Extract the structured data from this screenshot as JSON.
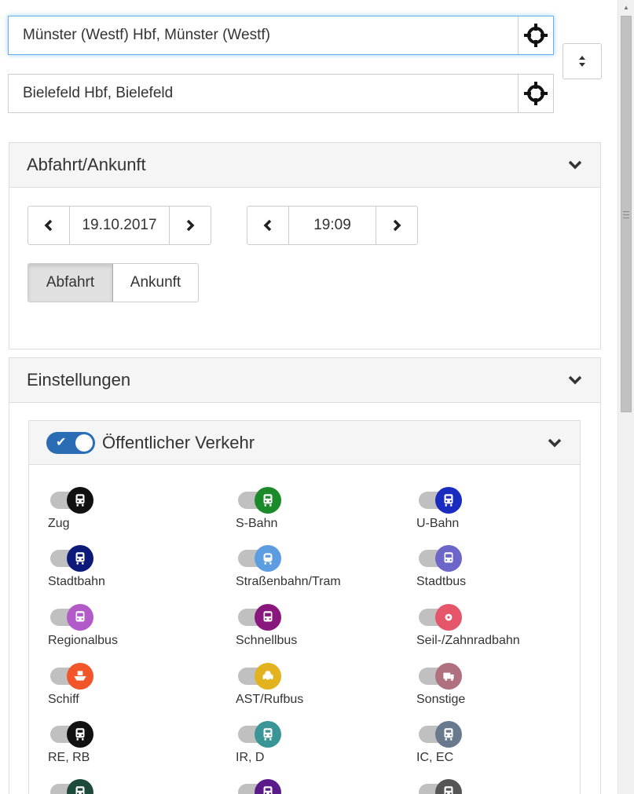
{
  "origin": {
    "value": "Münster (Westf) Hbf, Münster (Westf)",
    "locate_icon": "crosshair-icon"
  },
  "destination": {
    "value": "Bielefeld Hbf, Bielefeld",
    "locate_icon": "crosshair-icon"
  },
  "swap_icon": "sort-icon",
  "time_panel": {
    "title": "Abfahrt/Ankunft",
    "date": "19.10.2017",
    "time": "19:09",
    "departure_label": "Abfahrt",
    "arrival_label": "Ankunft",
    "selected": "Abfahrt"
  },
  "settings_panel": {
    "title": "Einstellungen",
    "public_transport": {
      "title": "Öffentlicher Verkehr",
      "enabled": true,
      "modes": [
        {
          "label": "Zug",
          "color": "#111111",
          "icon": "train-icon",
          "enabled": false
        },
        {
          "label": "S-Bahn",
          "color": "#1a8a2a",
          "icon": "train-icon",
          "enabled": false
        },
        {
          "label": "U-Bahn",
          "color": "#1a2bbf",
          "icon": "train-icon",
          "enabled": false
        },
        {
          "label": "Stadtbahn",
          "color": "#0d1a7a",
          "icon": "train-icon",
          "enabled": false
        },
        {
          "label": "Straßenbahn/Tram",
          "color": "#5b9de0",
          "icon": "tram-icon",
          "enabled": false
        },
        {
          "label": "Stadtbus",
          "color": "#6b66c7",
          "icon": "bus-icon",
          "enabled": false
        },
        {
          "label": "Regionalbus",
          "color": "#b35ac9",
          "icon": "bus-icon",
          "enabled": false
        },
        {
          "label": "Schnellbus",
          "color": "#8a177e",
          "icon": "bus-icon",
          "enabled": false
        },
        {
          "label": "Seil-/Zahnradbahn",
          "color": "#e5566a",
          "icon": "cable-car-icon",
          "enabled": false
        },
        {
          "label": "Schiff",
          "color": "#f2552a",
          "icon": "ship-icon",
          "enabled": false
        },
        {
          "label": "AST/Rufbus",
          "color": "#e3b21f",
          "icon": "taxi-icon",
          "enabled": false
        },
        {
          "label": "Sonstige",
          "color": "#b07080",
          "icon": "truck-icon",
          "enabled": false
        },
        {
          "label": "RE, RB",
          "color": "#111111",
          "icon": "train-icon",
          "enabled": false
        },
        {
          "label": "IR, D",
          "color": "#3a9696",
          "icon": "train-icon",
          "enabled": false
        },
        {
          "label": "IC, EC",
          "color": "#6a7a8e",
          "icon": "train-icon",
          "enabled": false
        },
        {
          "label": "",
          "color": "#1d4a3a",
          "icon": "train-icon",
          "enabled": false
        },
        {
          "label": "",
          "color": "#5a1a8a",
          "icon": "train-icon",
          "enabled": false
        },
        {
          "label": "",
          "color": "#555555",
          "icon": "train-icon",
          "enabled": false
        }
      ]
    }
  }
}
